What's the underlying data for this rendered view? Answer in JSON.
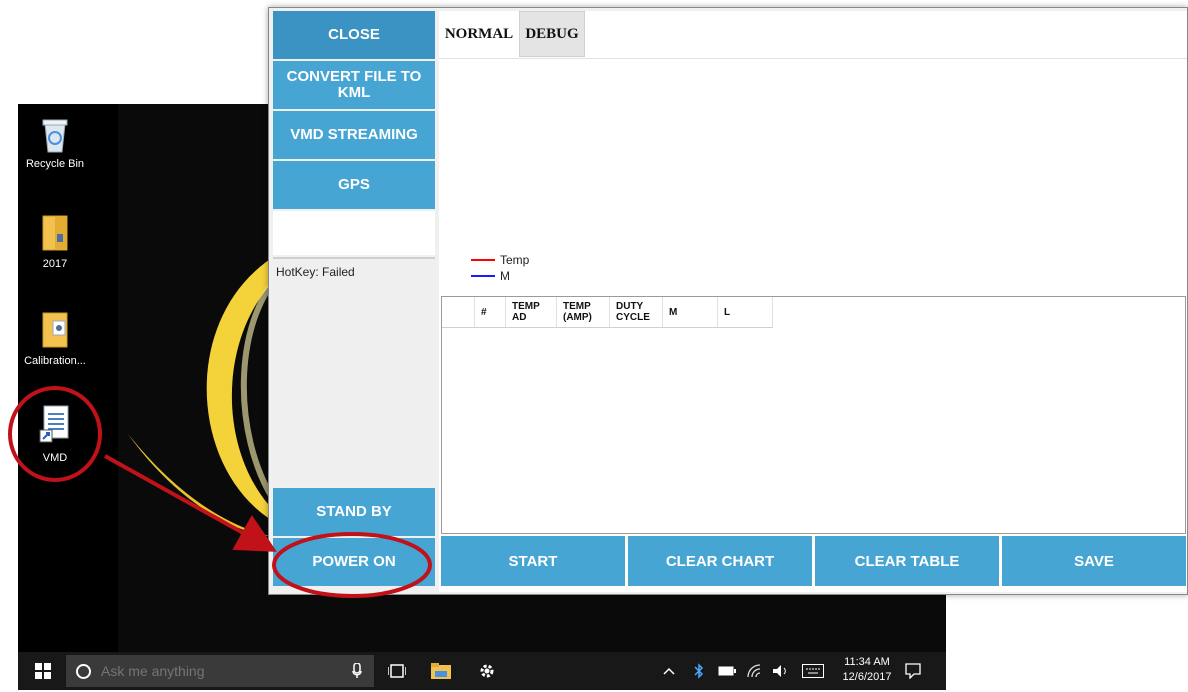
{
  "desktop": {
    "icons": [
      {
        "label": "Recycle Bin"
      },
      {
        "label": "2017"
      },
      {
        "label": "Calibration..."
      },
      {
        "label": "VMD"
      }
    ]
  },
  "taskbar": {
    "search_placeholder": "Ask me anything",
    "time": "11:34 AM",
    "date": "12/6/2017"
  },
  "app": {
    "side_buttons": {
      "close": "CLOSE",
      "convert": "CONVERT FILE TO KML",
      "vmd_streaming": "VMD STREAMING",
      "gps": "GPS",
      "stand_by": "STAND BY",
      "power_on": "POWER ON"
    },
    "log_text": "HotKey: Failed",
    "tabs": [
      "NORMAL",
      "DEBUG"
    ],
    "legend": [
      {
        "label": "Temp",
        "color": "#ff0000"
      },
      {
        "label": "M",
        "color": "#1a1aff"
      }
    ],
    "table_columns": [
      "",
      "#",
      "TEMP AD",
      "TEMP (AMP)",
      "DUTY CYCLE",
      "M",
      "L"
    ],
    "bottom_buttons": [
      "START",
      "CLEAR CHART",
      "CLEAR TABLE",
      "SAVE"
    ]
  },
  "colors": {
    "button_blue": "#47a5d4",
    "annotation_red": "#c1121a"
  }
}
